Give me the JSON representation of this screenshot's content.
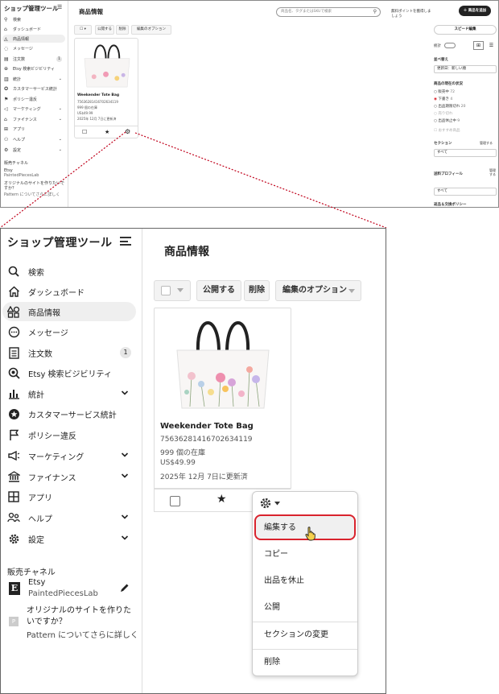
{
  "app": {
    "title": "ショップ管理ツール",
    "page_title": "商品情報"
  },
  "sidebar": {
    "items": [
      {
        "label": "検索",
        "icon": "search-icon"
      },
      {
        "label": "ダッシュボード",
        "icon": "home-icon"
      },
      {
        "label": "商品情報",
        "icon": "shapes-icon",
        "active": true
      },
      {
        "label": "メッセージ",
        "icon": "message-icon"
      },
      {
        "label": "注文数",
        "icon": "orders-icon",
        "badge": "1"
      },
      {
        "label": "Etsy 検索ビジビリティ",
        "icon": "search-visibility-icon"
      },
      {
        "label": "統計",
        "icon": "stats-icon",
        "expandable": true
      },
      {
        "label": "カスタマーサービス統計",
        "icon": "star-badge-icon"
      },
      {
        "label": "ポリシー違反",
        "icon": "flag-icon"
      },
      {
        "label": "マーケティング",
        "icon": "megaphone-icon",
        "expandable": true
      },
      {
        "label": "ファイナンス",
        "icon": "bank-icon",
        "expandable": true
      },
      {
        "label": "アプリ",
        "icon": "apps-icon"
      },
      {
        "label": "ヘルプ",
        "icon": "people-icon",
        "expandable": true
      },
      {
        "label": "設定",
        "icon": "gear-icon",
        "expandable": true
      }
    ],
    "channels_title": "販売チャネル",
    "etsy": {
      "name": "Etsy",
      "shop": "PaintedPiecesLab"
    },
    "pattern": {
      "line1": "オリジナルのサイトを作りたいですか？",
      "line2": "Pattern についてさらに詳しく"
    }
  },
  "toolbar": {
    "publish": "公開する",
    "delete": "削除",
    "edit_options": "編集のオプション"
  },
  "product": {
    "title": "Weekender Tote Bag",
    "id": "75636281416702634119",
    "stock": "999 個の在庫",
    "price": "US$49.99",
    "updated": "2025年 12月 7日に更新済"
  },
  "menu": {
    "items": [
      "編集する",
      "コピー",
      "出品を休止",
      "公開",
      "セクションの変更",
      "削除"
    ],
    "highlighted": "編集する"
  },
  "thumb": {
    "search_placeholder": "商品名、タグまたはSKUで検索",
    "promo": "無料ポイントを獲得しましょう",
    "add_button": "＋ 商品を追加",
    "speed_edit": "スピード編集",
    "stats_label": "統計",
    "sort_label": "並べ替え",
    "sort_value": "更新日：新しい順",
    "status_label": "商品の現在の状況",
    "status_options": [
      "販売中",
      "下書き",
      "出品期限切れ",
      "売り切れ",
      "出品休止中"
    ],
    "status_counts": [
      "72",
      "4",
      "20",
      "",
      "9"
    ],
    "featured": "おすすめ商品",
    "section_label": "セクション",
    "section_manage": "管理する",
    "section_value": "すべて",
    "shipping_label": "送料プロフィール",
    "shipping_manage": "管理する",
    "shipping_value": "すべて",
    "returns_label": "返品＆交換ポリシー"
  },
  "colors": {
    "highlight_border": "#d9232d",
    "connector": "#c0001a",
    "active_nav_bg": "#efefef"
  }
}
